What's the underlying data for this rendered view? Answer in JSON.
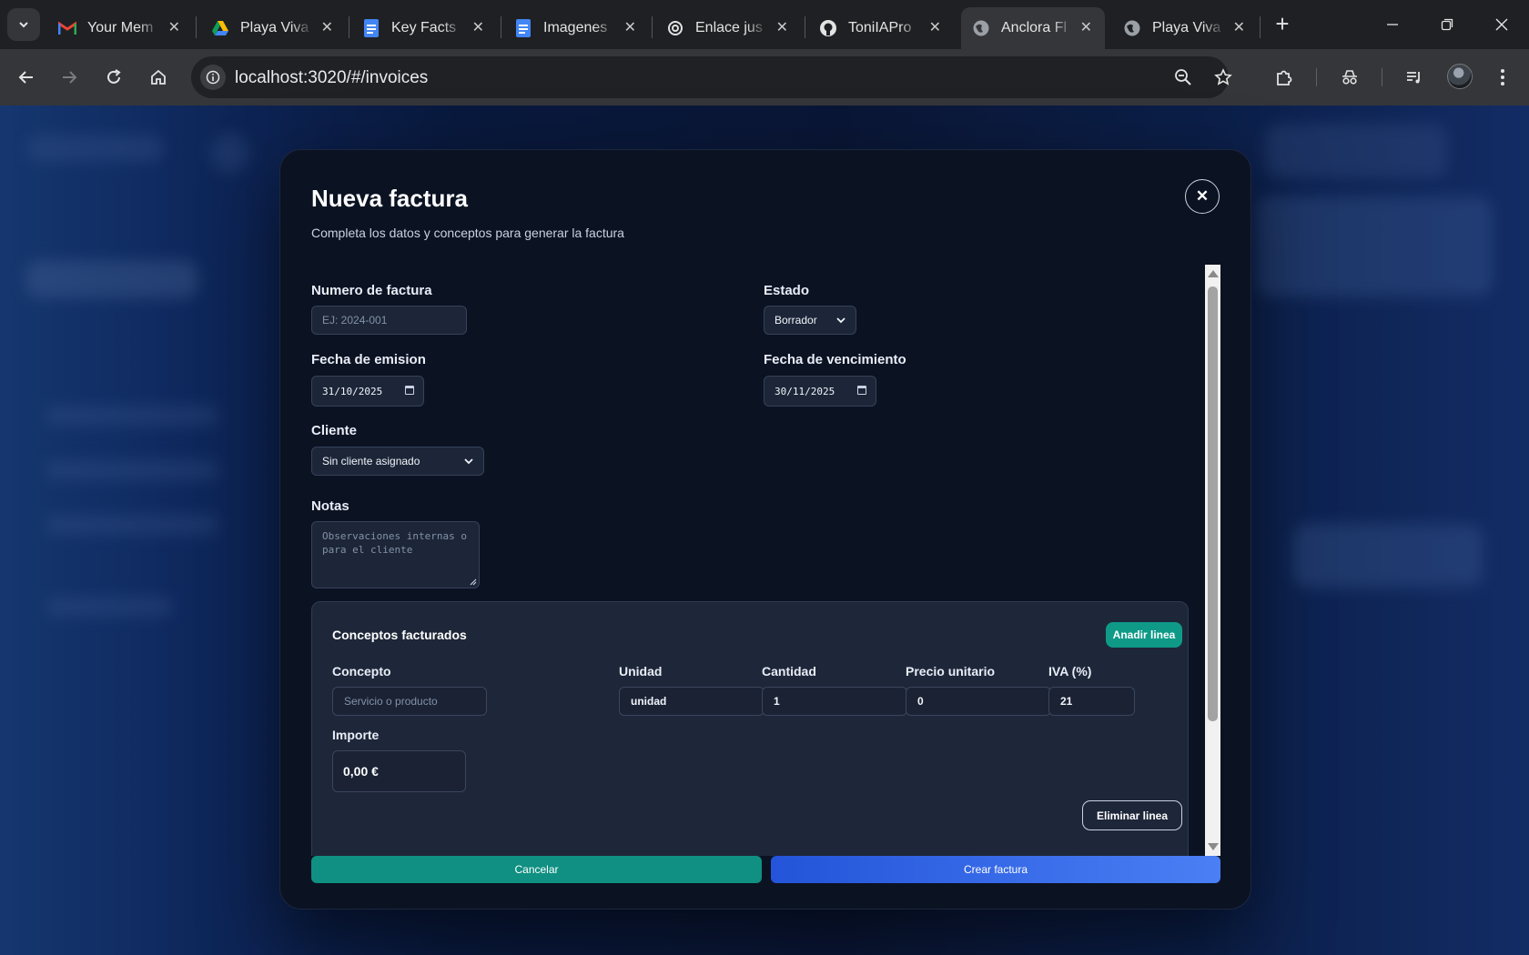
{
  "browser": {
    "tabs": [
      {
        "title": "Your Mem",
        "icon": "gmail-icon"
      },
      {
        "title": "Playa Viva",
        "icon": "google-drive-icon"
      },
      {
        "title": "Key Facts",
        "icon": "google-docs-icon"
      },
      {
        "title": "Imagenes",
        "icon": "google-docs-icon"
      },
      {
        "title": "Enlace jus",
        "icon": "openai-icon"
      },
      {
        "title": "ToniIAPro",
        "icon": "github-icon"
      },
      {
        "title": "Anclora Fl",
        "icon": "globe-icon",
        "active": true
      },
      {
        "title": "Playa Viva",
        "icon": "globe-icon"
      }
    ],
    "close_glyph": "✕",
    "new_tab_glyph": "+",
    "url": "localhost:3020/#/invoices"
  },
  "modal": {
    "title": "Nueva factura",
    "subtitle": "Completa los datos y conceptos para generar la factura",
    "close_glyph": "✕",
    "fields": {
      "invoice_number": {
        "label": "Numero de factura",
        "placeholder": "EJ: 2024-001",
        "value": ""
      },
      "status": {
        "label": "Estado",
        "value": "Borrador"
      },
      "issue_date": {
        "label": "Fecha de emision",
        "value": "31/10/2025"
      },
      "due_date": {
        "label": "Fecha de vencimiento",
        "value": "30/11/2025"
      },
      "client": {
        "label": "Cliente",
        "value": "Sin cliente asignado"
      },
      "notes": {
        "label": "Notas",
        "placeholder": "Observaciones internas o para el cliente",
        "placeholder_lines": [
          "Observaciones internas o",
          "para el cliente"
        ]
      }
    },
    "concepts": {
      "title": "Conceptos facturados",
      "add_label": "Anadir linea",
      "line": {
        "concept": {
          "label": "Concepto",
          "placeholder": "Servicio o producto"
        },
        "unit": {
          "label": "Unidad",
          "value": "unidad"
        },
        "quantity": {
          "label": "Cantidad",
          "value": "1"
        },
        "unit_price": {
          "label": "Precio unitario",
          "value": "0"
        },
        "vat": {
          "label": "IVA (%)",
          "value": "21"
        },
        "amount": {
          "label": "Importe",
          "value": "0,00 €"
        }
      },
      "delete_label": "Eliminar linea"
    },
    "actions": {
      "cancel": "Cancelar",
      "create": "Crear factura"
    }
  },
  "colors": {
    "accent_teal": "#0f9a88",
    "accent_blue": "#2f62e8",
    "modal_bg": "#0b1222"
  }
}
